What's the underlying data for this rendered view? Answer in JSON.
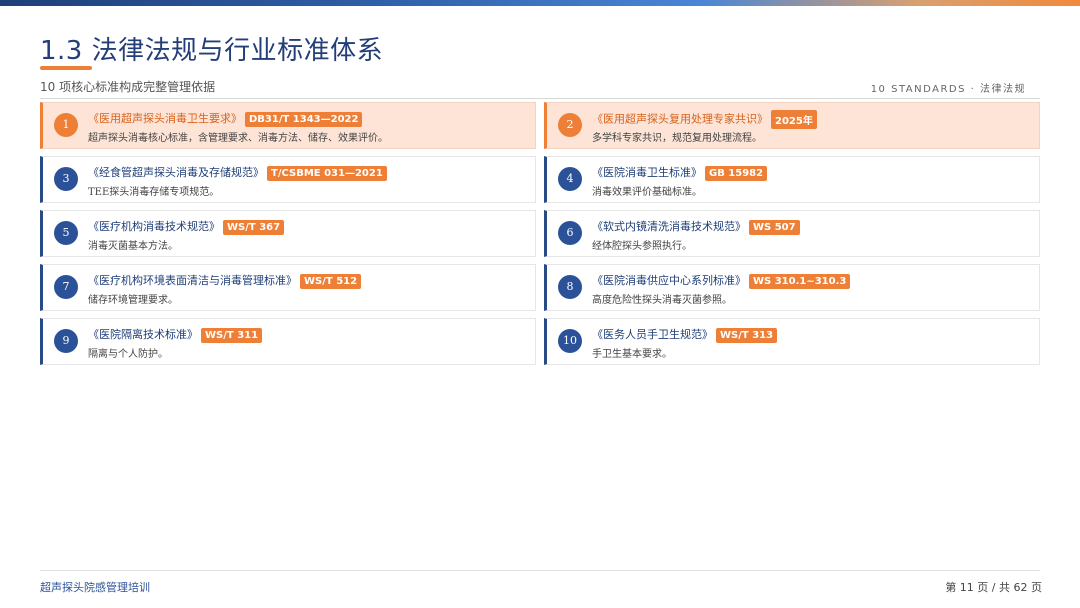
{
  "header": {
    "title": "1.3 法律法规与行业标准体系",
    "subtitle": "10 项核心标准构成完整管理依据",
    "right_tag": "10 STANDARDS · 法律法规"
  },
  "items": [
    {
      "num": "1",
      "title": "《医用超声探头消毒卫生要求》",
      "code": "DB31/T 1343—2022",
      "desc": "超声探头消毒核心标准，含管理要求、消毒方法、储存、效果评价。",
      "highlight": true
    },
    {
      "num": "2",
      "title": "《医用超声探头复用处理专家共识》",
      "code": "2025年",
      "desc": "多学科专家共识，规范复用处理流程。",
      "highlight": true
    },
    {
      "num": "3",
      "title": "《经食管超声探头消毒及存储规范》",
      "code": "T/CSBME 031—2021",
      "desc": "TEE探头消毒存储专项规范。",
      "highlight": false
    },
    {
      "num": "4",
      "title": "《医院消毒卫生标准》",
      "code": "GB 15982",
      "desc": "消毒效果评价基础标准。",
      "highlight": false
    },
    {
      "num": "5",
      "title": "《医疗机构消毒技术规范》",
      "code": "WS/T 367",
      "desc": "消毒灭菌基本方法。",
      "highlight": false
    },
    {
      "num": "6",
      "title": "《软式内镜清洗消毒技术规范》",
      "code": "WS 507",
      "desc": "经体腔探头参照执行。",
      "highlight": false
    },
    {
      "num": "7",
      "title": "《医疗机构环境表面清洁与消毒管理标准》",
      "code": "WS/T 512",
      "desc": "储存环境管理要求。",
      "highlight": false
    },
    {
      "num": "8",
      "title": "《医院消毒供应中心系列标准》",
      "code": "WS 310.1~310.3",
      "desc": "高度危险性探头消毒灭菌参照。",
      "highlight": false
    },
    {
      "num": "9",
      "title": "《医院隔离技术标准》",
      "code": "WS/T 311",
      "desc": "隔离与个人防护。",
      "highlight": false
    },
    {
      "num": "10",
      "title": "《医务人员手卫生规范》",
      "code": "WS/T 313",
      "desc": "手卫生基本要求。",
      "highlight": false
    }
  ],
  "footer": {
    "left": "超声探头院感管理培训",
    "right": "第 11 页 / 共 62 页"
  },
  "colors": {
    "accent": "#ee7f37",
    "primary": "#243f78",
    "highlight_bg": "#fde4d6"
  }
}
